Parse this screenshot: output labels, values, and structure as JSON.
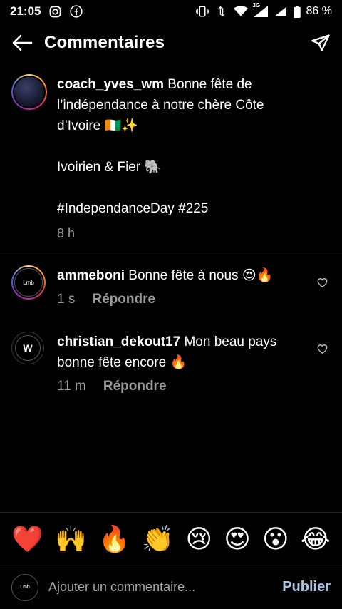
{
  "status_bar": {
    "time": "21:05",
    "battery": "86 %",
    "network": "3G"
  },
  "header": {
    "title": "Commentaires",
    "back_icon": "arrow-left-icon",
    "send_icon": "paper-plane-icon"
  },
  "caption": {
    "username": "coach_yves_wm",
    "text_line1": " Bonne fête de",
    "text_line2": "l’indépendance à notre chère Côte",
    "text_line3": "d’Ivoire 🇨🇮✨",
    "text_line4": "Ivoirien & Fier 🐘",
    "text_line5": "#IndependanceDay #225",
    "time": "8 h"
  },
  "comments": [
    {
      "username": "ammeboni",
      "text": " Bonne fête à nous 😍🔥",
      "time": "1 s",
      "reply": "Répondre",
      "avatar_text": "Lmb"
    },
    {
      "username": "christian_dekout17",
      "text": " Mon beau pays bonne fête encore 🔥",
      "time": "11 m",
      "reply": "Répondre",
      "avatar_text": "W"
    }
  ],
  "emoji_bar": [
    "❤️",
    "🙌",
    "🔥",
    "👏",
    "😢",
    "😍",
    "😮",
    "😂"
  ],
  "composer": {
    "placeholder": "Ajouter un commentaire...",
    "publish": "Publier",
    "avatar_text": "Lmb"
  },
  "colors": {
    "background": "#000000",
    "secondary_text": "#9a9a9a",
    "publish": "#a9c4e6"
  }
}
